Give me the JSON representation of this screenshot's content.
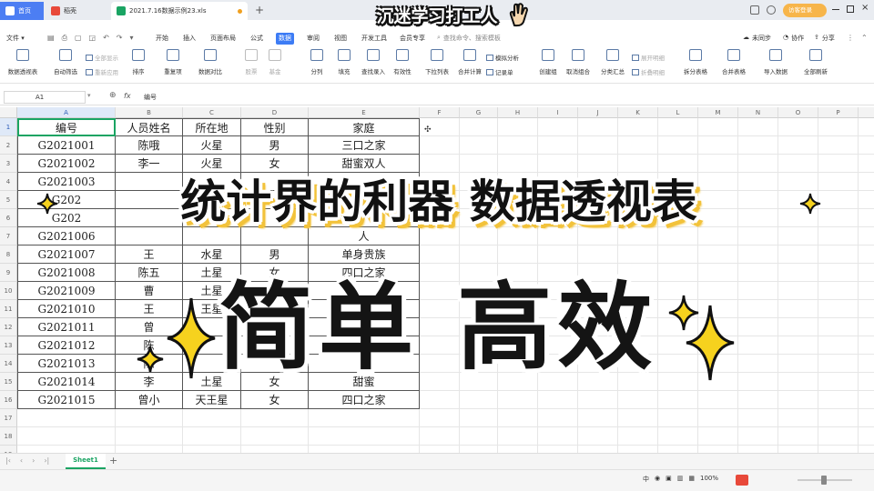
{
  "tabs": {
    "home": "首页",
    "doc": "稻壳",
    "file": "2021.7.16数据示例23.xls",
    "new_tab": "+"
  },
  "brand_overlay": "沉迷学习打工人",
  "top_right": {
    "login": "访客登录"
  },
  "menu": {
    "file": "文件",
    "items": [
      "开始",
      "插入",
      "页面布局",
      "公式",
      "数据",
      "审阅",
      "视图",
      "开发工具",
      "会员专享"
    ],
    "search": "查找命令、搜索模板",
    "sync": "未同步",
    "collab": "协作",
    "share": "分享"
  },
  "ribbon": {
    "pivot": "数据透视表",
    "auto_filter": "自动筛选",
    "show_all": "全部显示",
    "reapply": "重新应用",
    "sort": "排序",
    "dup": "重复项",
    "compare": "数据对比",
    "stock": "股票",
    "fund": "基金",
    "split": "分列",
    "fill": "填充",
    "lookup": "查找录入",
    "validity": "有效性",
    "dropdown": "下拉列表",
    "consolidate": "合并计算",
    "simulate": "模拟分析",
    "record": "记录单",
    "group": "创建组",
    "ungroup": "取消组合",
    "subtotal": "分类汇总",
    "expand": "展开明细",
    "collapse": "折叠明细",
    "split_table": "拆分表格",
    "merge_table": "合并表格",
    "import": "导入数据",
    "refresh": "全部刷新"
  },
  "formula_bar": {
    "cell_ref": "A1",
    "fx": "fx",
    "content": "编号"
  },
  "columns": [
    "A",
    "B",
    "C",
    "D",
    "E",
    "F",
    "G",
    "H",
    "I",
    "J",
    "K",
    "L",
    "M",
    "N",
    "O",
    "P",
    "Q"
  ],
  "rows": [
    "1",
    "2",
    "3",
    "4",
    "5",
    "6",
    "7",
    "8",
    "9",
    "10",
    "11",
    "12",
    "13",
    "14",
    "15",
    "16",
    "17",
    "18",
    "19"
  ],
  "table": {
    "headers": [
      "编号",
      "人员姓名",
      "所在地",
      "性别",
      "家庭"
    ],
    "rows": [
      [
        "G2021001",
        "陈哦",
        "火星",
        "男",
        "三口之家"
      ],
      [
        "G2021002",
        "李一",
        "火星",
        "女",
        "甜蜜双人"
      ],
      [
        "G2021003",
        "",
        "",
        "",
        ""
      ],
      [
        "G202",
        "",
        "",
        "",
        ""
      ],
      [
        "G202",
        "",
        "",
        "",
        ""
      ],
      [
        "G2021006",
        "",
        "",
        "",
        "人"
      ],
      [
        "G2021007",
        "王",
        "水星",
        "男",
        "单身贵族"
      ],
      [
        "G2021008",
        "陈五",
        "土星",
        "女",
        "四口之家"
      ],
      [
        "G2021009",
        "曹",
        "土星",
        "",
        ""
      ],
      [
        "G2021010",
        "王",
        "王星",
        "",
        ""
      ],
      [
        "G2021011",
        "曾",
        "",
        "",
        ""
      ],
      [
        "G2021012",
        "陈",
        "",
        "",
        ""
      ],
      [
        "G2021013",
        "陈",
        "",
        "",
        ""
      ],
      [
        "G2021014",
        "李",
        "土星",
        "女",
        "甜蜜"
      ],
      [
        "G2021015",
        "曾小",
        "天王星",
        "女",
        "四口之家"
      ]
    ]
  },
  "overlay": {
    "title": "统计界的利器 数据透视表",
    "main": "简单  高效"
  },
  "sheet": {
    "name": "Sheet1",
    "add": "+"
  },
  "status": {
    "ime": "中",
    "zoom": "100%"
  },
  "colors": {
    "accent": "#3d7cf5",
    "sheet_tab": "#1aa463",
    "sparkle": "#f6d21e",
    "title_glow": "#f2c23a"
  }
}
